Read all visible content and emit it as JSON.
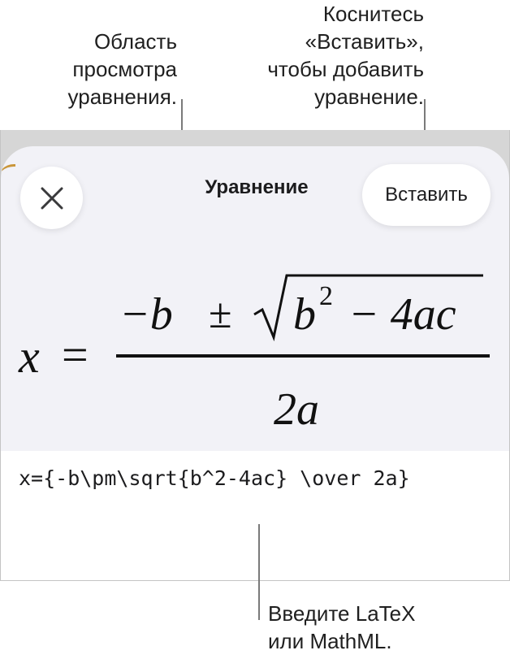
{
  "callouts": {
    "preview": "Область\nпросмотра\nуравнения.",
    "insert": "Коснитесь\n«Вставить»,\nчтобы добавить\nуравнение.",
    "input": "Введите LaTeX\nили MathML."
  },
  "sheet": {
    "title": "Уравнение",
    "insert_label": "Вставить",
    "close_icon": "close-icon"
  },
  "equation": {
    "lhs": "x",
    "equals": "=",
    "numerator_minus_b": "−b",
    "plus_minus": "±",
    "radicand_b": "b",
    "exponent": "2",
    "radicand_rest": "− 4ac",
    "denominator": "2a"
  },
  "input": {
    "value": "x={-b\\pm\\sqrt{b^2-4ac} \\over 2a}"
  },
  "colors": {
    "accent_border": "#c9963a",
    "sheet_background": "#f2f2f7",
    "device_background": "#d6d6d6"
  }
}
